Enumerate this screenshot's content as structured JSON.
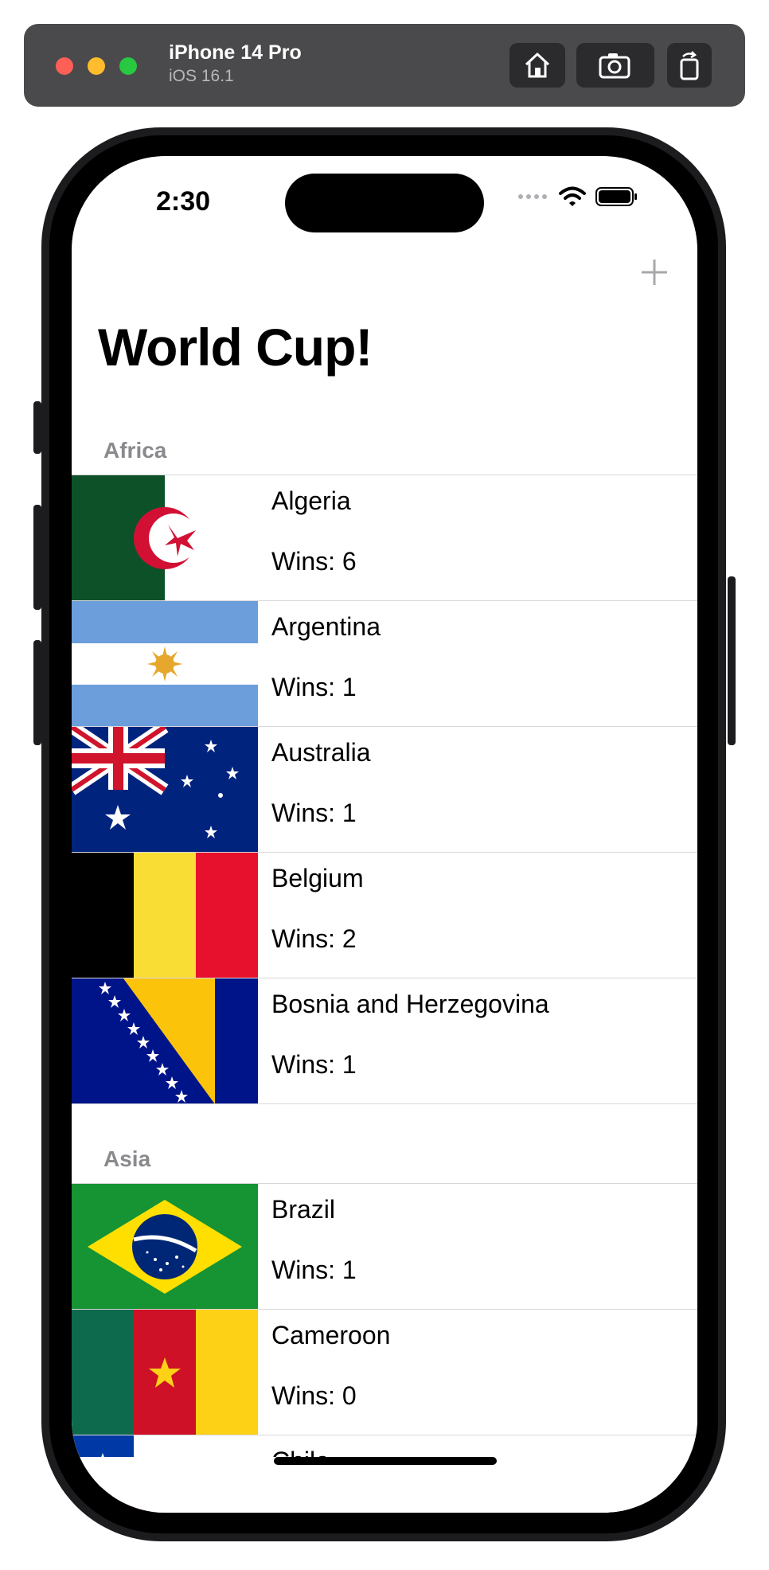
{
  "simulator": {
    "device_name": "iPhone 14 Pro",
    "os_version": "iOS 16.1",
    "icons": [
      "home-icon",
      "screenshot-icon",
      "rotate-icon"
    ]
  },
  "status_bar": {
    "time": "2:30",
    "icons": [
      "signal-icon",
      "wifi-icon",
      "battery-icon"
    ]
  },
  "nav": {
    "title": "World Cup!",
    "add_icon": "plus-icon"
  },
  "sections": [
    {
      "header": "Africa",
      "rows": [
        {
          "country": "Algeria",
          "wins": "Wins: 6"
        },
        {
          "country": "Argentina",
          "wins": "Wins: 1"
        },
        {
          "country": "Australia",
          "wins": "Wins: 1"
        },
        {
          "country": "Belgium",
          "wins": "Wins: 2"
        },
        {
          "country": "Bosnia and Herzegovina",
          "wins": "Wins: 1"
        }
      ]
    },
    {
      "header": "Asia",
      "rows": [
        {
          "country": "Brazil",
          "wins": "Wins: 1"
        },
        {
          "country": "Cameroon",
          "wins": "Wins: 0"
        },
        {
          "country": "Chile",
          "wins": ""
        }
      ]
    }
  ],
  "colors": {
    "accent": "#007aff",
    "section_header": "#8a8a8e",
    "separator": "#d8d8dc"
  }
}
